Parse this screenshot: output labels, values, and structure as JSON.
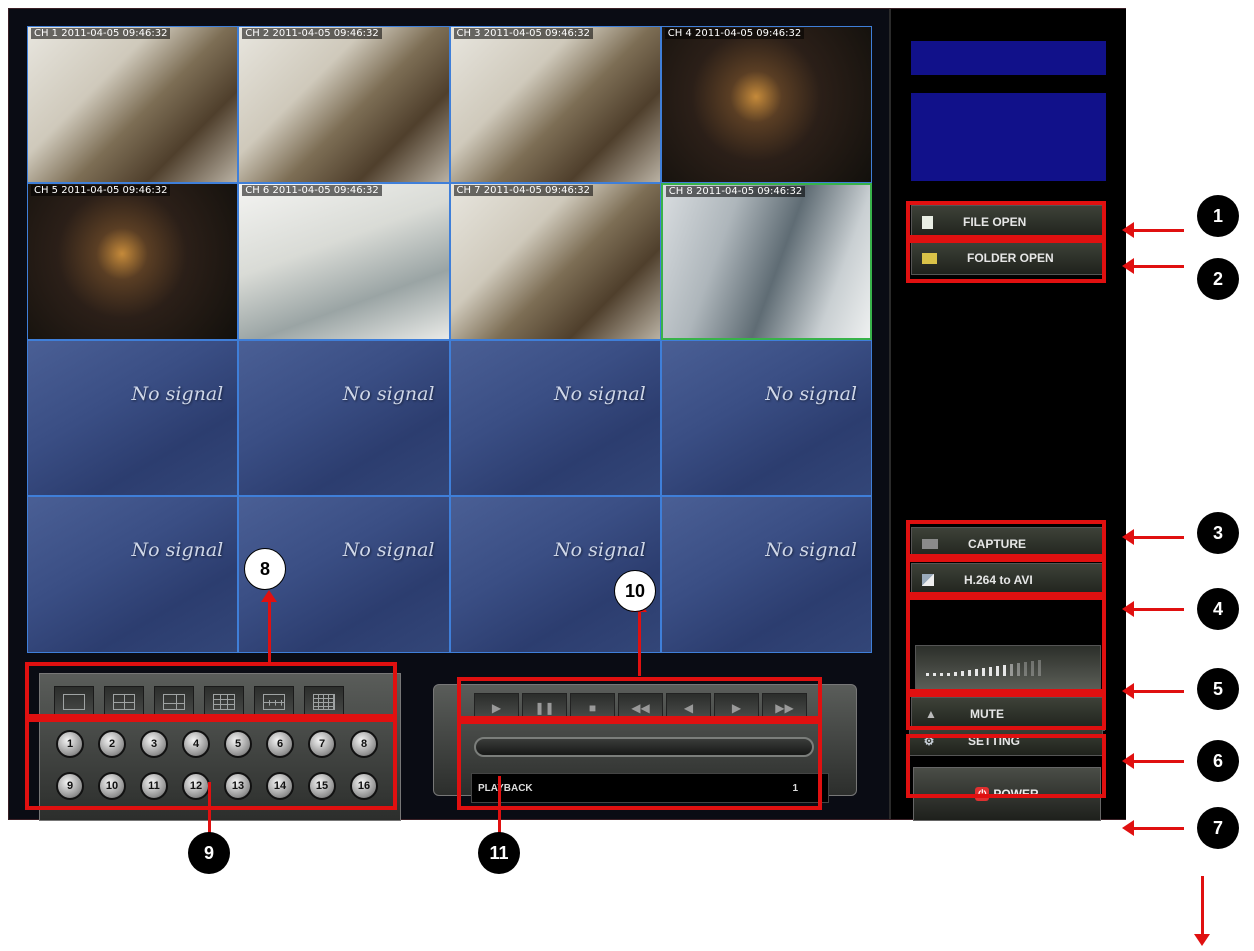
{
  "channels": [
    {
      "caption": "CH 1 2011-04-05 09:46:32"
    },
    {
      "caption": "CH 2 2011-04-05 09:46:32"
    },
    {
      "caption": "CH 3 2011-04-05 09:46:32"
    },
    {
      "caption": "CH 4 2011-04-05 09:46:32"
    },
    {
      "caption": "CH 5 2011-04-05 09:46:32"
    },
    {
      "caption": "CH 6 2011-04-05 09:46:32"
    },
    {
      "caption": "CH 7 2011-04-05 09:46:32"
    },
    {
      "caption": "CH 8 2011-04-05 09:46:32"
    }
  ],
  "no_signal_label": "No signal",
  "sidebar": {
    "file_open": "FILE OPEN",
    "folder_open": "FOLDER OPEN",
    "capture": "CAPTURE",
    "h264_to_avi": "H.264 to AVI",
    "mute": "MUTE",
    "setting": "SETTING",
    "power": "POWER"
  },
  "channel_buttons": [
    "1",
    "2",
    "3",
    "4",
    "5",
    "6",
    "7",
    "8",
    "9",
    "10",
    "11",
    "12",
    "13",
    "14",
    "15",
    "16"
  ],
  "playback": {
    "label": "PLAYBACK",
    "value": "1"
  },
  "callouts": [
    "1",
    "2",
    "3",
    "4",
    "5",
    "6",
    "7",
    "8",
    "9",
    "10",
    "11"
  ],
  "colors": {
    "accent_red": "#e01010",
    "selected_border": "#38b24a",
    "info_panel": "#11118a"
  }
}
